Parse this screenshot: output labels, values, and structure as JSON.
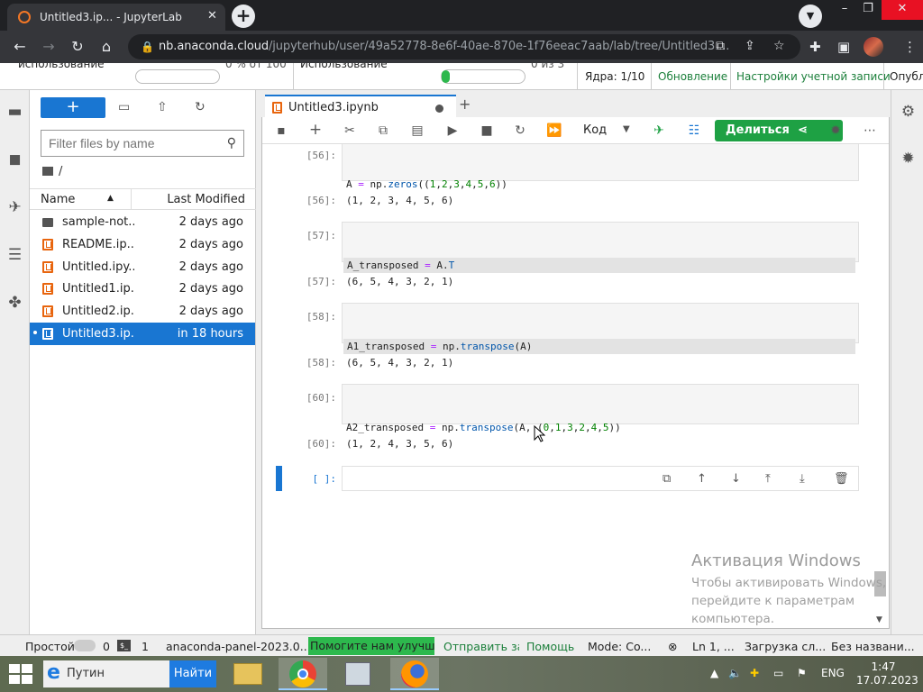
{
  "browser": {
    "tab_title": "Untitled3.ip... - JupyterLab",
    "tab_close": "✕",
    "new_tab": "+",
    "url_host": "nb.anaconda.cloud",
    "url_path": "/jupyterhub/user/49a52778-8e6f-40ae-870e-1f76eeac7aab/lab/tree/Untitled3....",
    "window_min": "–",
    "window_max": "❐",
    "window_close": "✕"
  },
  "jupyter_top": {
    "usage_label_1": "использование",
    "usage_value_1": "0 % от 100",
    "usage_label_2": "Использование",
    "usage_value_2": "0 из 3",
    "usage_fill_2": 0.03,
    "kernels": "Ядра: 1/10",
    "update": "Обновление",
    "account_settings": "Настройки учетной записи",
    "publish": "Опубл"
  },
  "file_browser": {
    "filter_placeholder": "Filter files by name",
    "breadcrumb": "/",
    "col_name": "Name",
    "col_modified": "Last Modified",
    "files": [
      {
        "name": "sample-not...",
        "modified": "2 days ago",
        "kind": "folder"
      },
      {
        "name": "README.ip...",
        "modified": "2 days ago",
        "kind": "notebook"
      },
      {
        "name": "Untitled.ipy...",
        "modified": "2 days ago",
        "kind": "notebook"
      },
      {
        "name": "Untitled1.ip...",
        "modified": "2 days ago",
        "kind": "notebook"
      },
      {
        "name": "Untitled2.ip...",
        "modified": "2 days ago",
        "kind": "notebook"
      },
      {
        "name": "Untitled3.ip...",
        "modified": "in 18 hours",
        "kind": "notebook",
        "selected": true
      }
    ]
  },
  "notebook": {
    "tab_title": "Untitled3.ipynb",
    "cell_type": "Код",
    "share_label": "Делиться",
    "cells": [
      {
        "prompt_in": "[56]:",
        "prompt_out": "[56]:",
        "output": "(1, 2, 3, 4, 5, 6)"
      },
      {
        "prompt_in": "[57]:",
        "prompt_out": "[57]:",
        "output": "(6, 5, 4, 3, 2, 1)"
      },
      {
        "prompt_in": "[58]:",
        "prompt_out": "[58]:",
        "output": "(6, 5, 4, 3, 2, 1)"
      },
      {
        "prompt_in": "[60]:",
        "prompt_out": "[60]:",
        "output": "(1, 2, 4, 3, 5, 6)"
      }
    ],
    "empty_prompt": "[ ]:"
  },
  "watermark": {
    "title": "Активация Windows",
    "text": "Чтобы активировать Windows, перейдите к параметрам компьютера."
  },
  "statusbar": {
    "mode": "Простой",
    "count1": "0",
    "count2": "1",
    "panel": "anaconda-panel-2023.0...",
    "help": "Помогите нам улучшить",
    "send": "Отправить за",
    "help2": "Помощь",
    "code_mode": "Mode: Co...",
    "ln": "Ln 1, ...",
    "loading": "Загрузка сл...",
    "untitled": "Без названи..."
  },
  "taskbar": {
    "search_text": "Путин",
    "search_button": "Найти",
    "lang": "ENG",
    "time": "1:47",
    "date": "17.07.2023"
  }
}
